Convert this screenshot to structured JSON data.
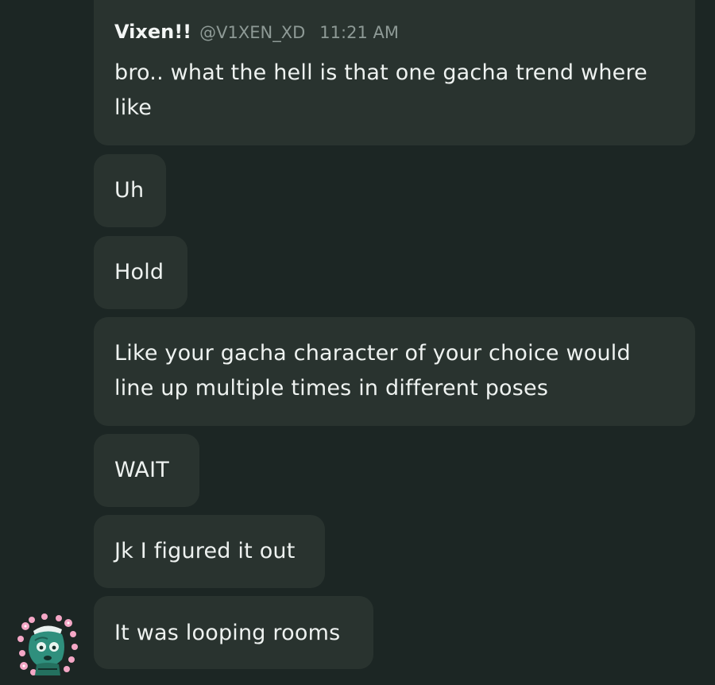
{
  "first_message": {
    "author": "Vixen!!",
    "handle": "@V1XEN_XD",
    "timestamp": "11:21 AM",
    "text": "bro.. what the hell is that one gacha trend where like"
  },
  "messages": [
    {
      "text": "Uh"
    },
    {
      "text": "Hold"
    },
    {
      "text": "Like your gacha character of your choice would line up multiple times in different poses"
    },
    {
      "text": "WAIT"
    },
    {
      "text": "Jk I figured it out"
    },
    {
      "text": "It was looping rooms"
    }
  ],
  "colors": {
    "background": "#1c2624",
    "bubble": "#29332f",
    "text": "#eef2f0",
    "muted": "#8e9a96"
  }
}
